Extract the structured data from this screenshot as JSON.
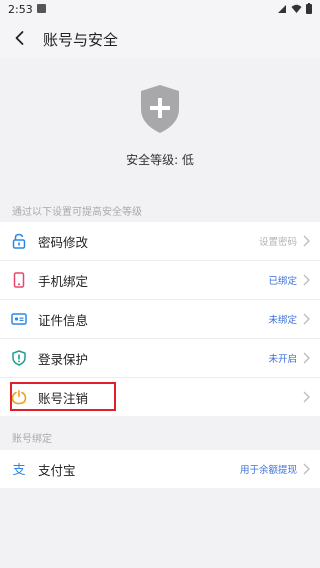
{
  "status_bar": {
    "time": "2:53"
  },
  "header": {
    "title": "账号与安全"
  },
  "hero": {
    "level_text": "安全等级: 低"
  },
  "section1": {
    "tip": "通过以下设置可提高安全等级"
  },
  "security_items": [
    {
      "label": "密码修改",
      "value": "设置密码",
      "value_color": "#b3b3b3",
      "icon": "lock-icon"
    },
    {
      "label": "手机绑定",
      "value": "已绑定",
      "value_color": "#3d6fd8",
      "icon": "phone-icon"
    },
    {
      "label": "证件信息",
      "value": "未绑定",
      "value_color": "#3d6fd8",
      "icon": "id-card-icon"
    },
    {
      "label": "登录保护",
      "value": "未开启",
      "value_color": "#3d6fd8",
      "icon": "shield-alert-icon"
    },
    {
      "label": "账号注销",
      "value": "",
      "value_color": "#3d6fd8",
      "icon": "power-icon"
    }
  ],
  "section2": {
    "tip": "账号绑定"
  },
  "binding_items": [
    {
      "label": "支付宝",
      "value": "用于余额提现",
      "value_color": "#3d6fd8",
      "icon": "alipay-icon"
    }
  ]
}
